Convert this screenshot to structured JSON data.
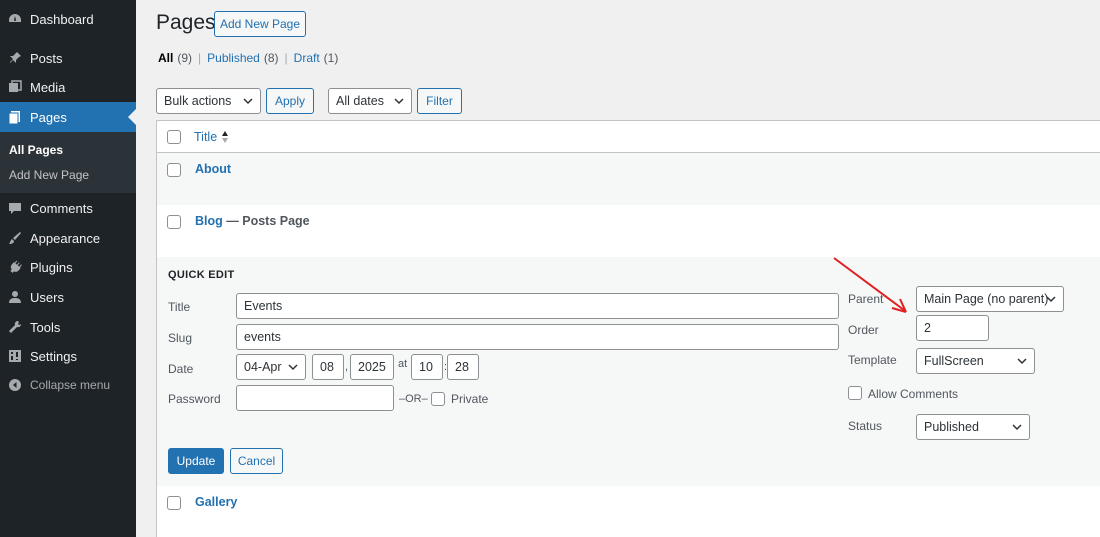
{
  "sidebar": {
    "items": [
      {
        "label": "Dashboard",
        "icon": "dashboard-icon"
      },
      {
        "label": "Posts",
        "icon": "pin-icon"
      },
      {
        "label": "Media",
        "icon": "media-icon"
      },
      {
        "label": "Pages",
        "icon": "pages-icon"
      },
      {
        "label": "Comments",
        "icon": "comment-icon"
      },
      {
        "label": "Appearance",
        "icon": "brush-icon"
      },
      {
        "label": "Plugins",
        "icon": "plug-icon"
      },
      {
        "label": "Users",
        "icon": "user-icon"
      },
      {
        "label": "Tools",
        "icon": "wrench-icon"
      },
      {
        "label": "Settings",
        "icon": "settings-icon"
      }
    ],
    "submenu": {
      "all_pages": "All Pages",
      "add_new": "Add New Page"
    },
    "collapse": "Collapse menu"
  },
  "header": {
    "title": "Pages",
    "add_new": "Add New Page"
  },
  "filters": {
    "all": "All",
    "all_count": "(9)",
    "published": "Published",
    "published_count": "(8)",
    "draft": "Draft",
    "draft_count": "(1)",
    "sep": "|"
  },
  "toolbar": {
    "bulk_actions": "Bulk actions",
    "apply": "Apply",
    "all_dates": "All dates",
    "filter": "Filter"
  },
  "table": {
    "column_title": "Title",
    "rows": [
      {
        "title": "About",
        "state": ""
      },
      {
        "title": "Blog",
        "state": " — Posts Page"
      },
      {
        "title": "Gallery",
        "state": ""
      }
    ]
  },
  "quick_edit": {
    "heading": "QUICK EDIT",
    "title_label": "Title",
    "title_value": "Events",
    "slug_label": "Slug",
    "slug_value": "events",
    "date_label": "Date",
    "month": "04-Apr",
    "day": "08",
    "year": "2025",
    "at": "at",
    "hour": "10",
    "minute": "28",
    "comma": ",",
    "colon": ":",
    "password_label": "Password",
    "or": "–OR–",
    "private": "Private",
    "parent_label": "Parent",
    "parent_value": "Main Page (no parent)",
    "order_label": "Order",
    "order_value": "2",
    "template_label": "Template",
    "template_value": "FullScreen",
    "allow_comments": "Allow Comments",
    "status_label": "Status",
    "status_value": "Published",
    "update": "Update",
    "cancel": "Cancel"
  },
  "colors": {
    "accent": "#2271b1",
    "sidebar_bg": "#1d2327",
    "annotation": "#e02020"
  }
}
